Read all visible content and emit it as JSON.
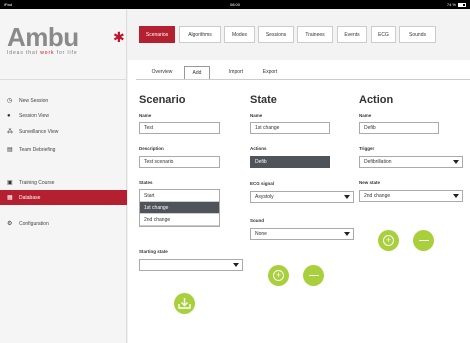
{
  "status_bar": {
    "left": "iPad",
    "center": "08:00",
    "right": "74 %"
  },
  "brand": {
    "name": "Ambu",
    "tagline_start": "Ideas that ",
    "tagline_red": "work",
    "tagline_end": " for life"
  },
  "sidebar": {
    "items": [
      {
        "label": "New Session",
        "icon": "clock-icon"
      },
      {
        "label": "Session View",
        "icon": "person-icon"
      },
      {
        "label": "Surveillance View",
        "icon": "people-icon"
      },
      {
        "label": "Team Debriefing",
        "icon": "document-icon"
      },
      {
        "label": "Training Course",
        "icon": "calendar-icon"
      },
      {
        "label": "Database",
        "icon": "database-icon"
      },
      {
        "label": "Configuration",
        "icon": "wrench-icon"
      }
    ]
  },
  "tabs": [
    "Scenarios",
    "Algorithms",
    "Modes",
    "Sessions",
    "Trainees",
    "Events",
    "ECG",
    "Sounds"
  ],
  "subtabs": [
    "Overview",
    "Add",
    "Import",
    "Export"
  ],
  "scenario": {
    "title": "Scenario",
    "name_label": "Name",
    "name_value": "Test",
    "description_label": "Description",
    "description_value": "Test scenario",
    "states_label": "States",
    "states": [
      "Start",
      "1st change",
      "2nd change"
    ],
    "starting_state_label": "Starting state",
    "starting_state_value": ""
  },
  "state": {
    "title": "State",
    "name_label": "Name",
    "name_value": "1st change",
    "actions_label": "Actions",
    "actions_value": "Defib",
    "ecg_label": "ECG signal",
    "ecg_value": "Asystoly",
    "sound_label": "Sound",
    "sound_value": "None"
  },
  "action": {
    "title": "Action",
    "name_label": "Name",
    "name_value": "Defib",
    "trigger_label": "Trigger",
    "trigger_value": "Defibrillation",
    "new_state_label": "New state",
    "new_state_value": "2nd change"
  },
  "colors": {
    "brand_red": "#b4202f",
    "accent_green": "#a8cf3c",
    "selected_dark": "#4e545a"
  }
}
